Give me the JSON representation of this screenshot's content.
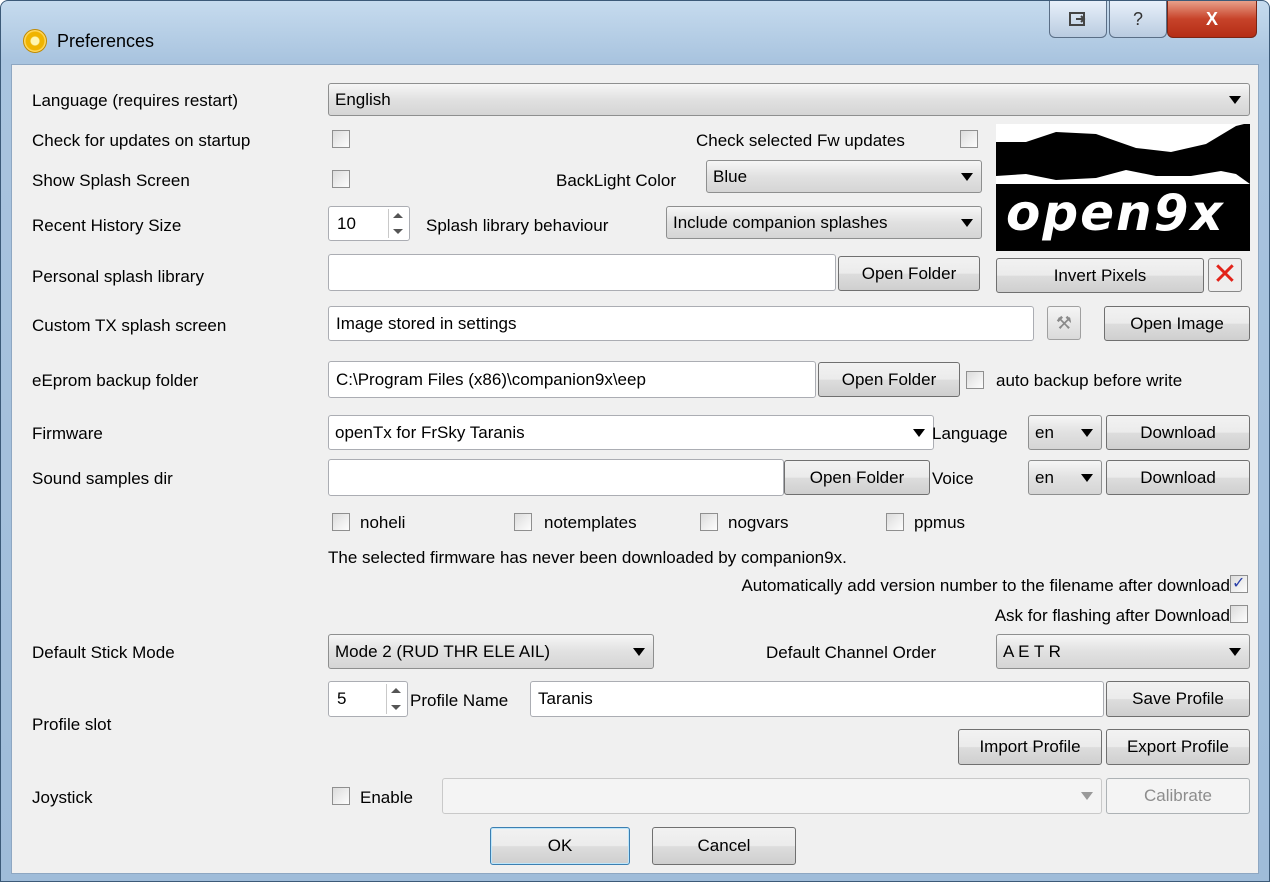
{
  "window": {
    "title": "Preferences",
    "close_symbol": "X",
    "help_symbol": "?"
  },
  "labels": {
    "language": "Language (requires restart)",
    "check_updates": "Check for updates on startup",
    "check_fw_updates": "Check selected Fw updates",
    "show_splash": "Show Splash Screen",
    "backlight_color": "BackLight Color",
    "recent_history": "Recent History Size",
    "splash_library_behaviour": "Splash library behaviour",
    "personal_splash": "Personal splash library",
    "custom_tx_splash": "Custom TX splash screen",
    "eeprom_backup": "eEprom backup folder",
    "auto_backup": "auto backup before write",
    "firmware": "Firmware",
    "fw_language": "Language",
    "sound_samples": "Sound samples dir",
    "voice": "Voice",
    "default_stick_mode": "Default Stick Mode",
    "default_channel_order": "Default Channel Order",
    "profile_slot": "Profile slot",
    "profile_name": "Profile Name",
    "joystick": "Joystick",
    "enable": "Enable"
  },
  "values": {
    "language": "English",
    "backlight_color": "Blue",
    "recent_history": "10",
    "splash_library_behaviour": "Include companion splashes",
    "personal_splash_path": "",
    "custom_tx_splash": "Image stored in settings",
    "eeprom_backup_path": "C:\\Program Files (x86)\\companion9x\\eep",
    "firmware": "openTx for FrSky Taranis",
    "fw_language": "en",
    "sound_samples_path": "",
    "voice": "en",
    "default_stick_mode": "Mode 2 (RUD THR ELE AIL)",
    "default_channel_order": "A E T R",
    "profile_slot": "5",
    "profile_name": "Taranis",
    "joystick": ""
  },
  "options": {
    "noheli": "noheli",
    "notemplates": "notemplates",
    "nogvars": "nogvars",
    "ppmus": "ppmus"
  },
  "messages": {
    "fw_not_downloaded": "The selected firmware has never been downloaded by companion9x.",
    "auto_version": "Automatically add version number to the filename after download",
    "ask_flashing": "Ask for flashing after Download"
  },
  "checkbox_states": {
    "check_updates": false,
    "check_fw_updates": false,
    "show_splash": false,
    "auto_backup": false,
    "noheli": false,
    "notemplates": false,
    "nogvars": false,
    "ppmus": false,
    "auto_version": true,
    "ask_flashing": false,
    "joystick_enable": false
  },
  "buttons": {
    "open_folder": "Open Folder",
    "invert_pixels": "Invert Pixels",
    "open_image": "Open Image",
    "download": "Download",
    "save_profile": "Save Profile",
    "import_profile": "Import Profile",
    "export_profile": "Export Profile",
    "calibrate": "Calibrate",
    "ok": "OK",
    "cancel": "Cancel"
  },
  "splash": {
    "text": "open9x"
  },
  "icons": {
    "app": "preferences-gear-icon",
    "restore": "restore-window-icon",
    "help": "help-icon",
    "close": "close-icon",
    "clear_splash": "red-x-icon",
    "tool": "wrench-icon"
  },
  "colors": {
    "close_button": "#c7432a",
    "clear_splash_x": "#e2231a",
    "accent_check": "#2a3fa8"
  }
}
